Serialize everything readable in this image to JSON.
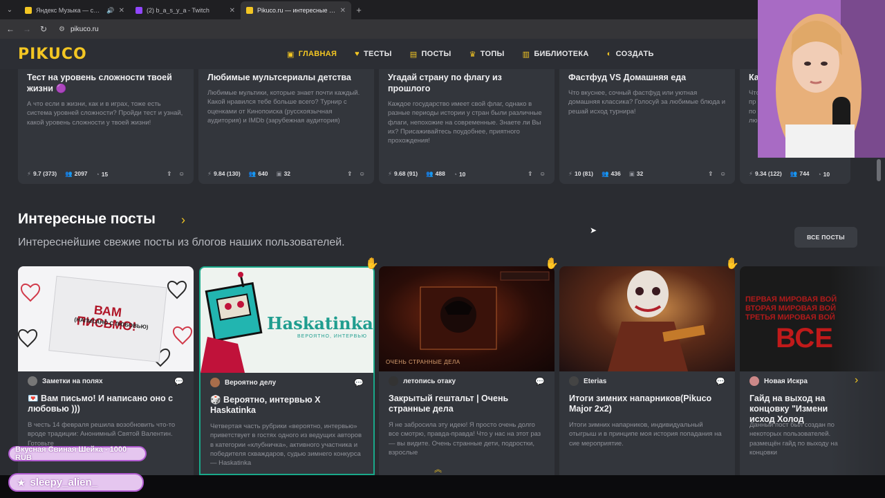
{
  "browser": {
    "tabs": [
      {
        "title": "Яндекс Музыка — собира",
        "favicon_color": "#f3c623",
        "audio": true
      },
      {
        "title": "(2) b_a_s_y_a - Twitch",
        "favicon_color": "#9146ff",
        "audio": false
      },
      {
        "title": "Pikuco.ru — интересные тесты",
        "favicon_color": "#f3c623",
        "audio": false,
        "active": true
      }
    ],
    "url": "pikuco.ru"
  },
  "site": {
    "logo": "PIKUCO",
    "nav": [
      {
        "label": "ГЛАВНАЯ",
        "icon": "home-icon",
        "active": true
      },
      {
        "label": "ТЕСТЫ",
        "icon": "heart-icon"
      },
      {
        "label": "ПОСТЫ",
        "icon": "document-icon"
      },
      {
        "label": "ТОПЫ",
        "icon": "trophy-icon"
      },
      {
        "label": "БИБЛИОТЕКА",
        "icon": "book-icon"
      },
      {
        "label": "СОЗДАТЬ",
        "icon": "bulb-icon"
      }
    ],
    "accent_color": "#f3c623"
  },
  "tests": [
    {
      "title": "Тест на уровень сложности твоей жизни 🟣",
      "desc": "А что если в жизни, как и в играх, тоже есть система уровней сложности? Пройди тест и узнай, какой уровень сложности у твоей жизни!",
      "rating": "9.7",
      "votes": "373",
      "plays": "2097",
      "questions": "15"
    },
    {
      "title": "Любимые мультсериалы детства",
      "desc": "Любимые мультики, которые знает почти каждый. Какой нравился тебе больше всего? Турнир с оценками от Кинопоиска (русскоязычная аудитория) и IMDb (зарубежная аудитория)",
      "rating": "9.84",
      "votes": "130",
      "plays": "640",
      "questions": "32"
    },
    {
      "title": "Угадай страну по флагу из прошлого",
      "desc": "Каждое государство имеет свой флаг, однако в разные периоды истории у стран были различные флаги, непохожие на современные. Знаете ли Вы их? Присаживайтесь поудобнее, приятного прохождения!",
      "rating": "9.68",
      "votes": "91",
      "plays": "488",
      "questions": "10"
    },
    {
      "title": "Фастфуд VS Домашняя еда",
      "desc": "Что вкуснее, сочный фастфуд или уютная домашняя классика? Голосуй за любимые блюда и решай исход турнира!",
      "rating": "10",
      "votes": "81",
      "plays": "436",
      "questions": "32"
    },
    {
      "title": "Ка",
      "desc": "Что пр по лю",
      "rating": "9.34",
      "votes": "122",
      "plays": "744",
      "questions": "10"
    }
  ],
  "posts_section": {
    "title": "Интересные посты",
    "subtitle": "Интереснейшие свежие посты из блогов наших пользователей.",
    "all_button": "ВСЕ ПОСТЫ"
  },
  "posts": [
    {
      "author": "Заметки на полях",
      "title": "💌 Вам письмо! И написано оно с любовью )))",
      "desc": "В честь 14 февраля решила возобновить что-то вроде традиции: Анонимный Святой Валентин. Готовьте",
      "image_text": "ВАМ ПИСЬМО!",
      "image_subtext": "(НАПИСАНО С ЛЮБОВЬЮ)"
    },
    {
      "author": "Вероятно делу",
      "title": "🎲 Вероятно, интервью X Haskatinka",
      "desc": "Четвертая часть рубрики «вероятно, интервью» приветствует в гостях одного из ведущих авторов в категории «клубничка», активного участника и победителя скваждаров, судью зимнего конкурса — Haskatinka",
      "image_text": "Haskatinka",
      "image_subtext": "ВЕРОЯТНО, ИНТЕРВЬЮ"
    },
    {
      "author": "летопись отаку",
      "title": "Закрытый гештальт | Очень странные дела",
      "desc": "Я не забросила эту идею! Я просто очень долго все смотрю, правда-правда! Что у нас на этот раз — вы видите. Очень странные дети, подростки, взрослые",
      "image_text": "ОЧЕНЬ СТРАННЫЕ ДЕЛА"
    },
    {
      "author": "Eterias",
      "title": "Итоги зимних напарников(Pikuco Major 2x2)",
      "desc": "Итоги зимних напарников, индивидуальный отыгрыш и в принципе моя история попадания на сие мероприятие."
    },
    {
      "author": "Новая Искра",
      "title": "Гайд на выход на концовку \"Измени исход Холод",
      "desc": "Данный пост был создан по некоторых пользователей. размещён гайд по выходу на концовки",
      "image_text": "ПЕРВАЯ МИРОВАЯ ВОЙ ВТОРАЯ МИРОВАЯ ВОЙ ТРЕТЬЯ МИРОВАЯ ВОЙ",
      "image_big": "ВСЕ"
    }
  ],
  "overlay": {
    "donation": "Вкусная Свиная Шейка - 1000 RUB",
    "user": "sleepy_alien_"
  }
}
